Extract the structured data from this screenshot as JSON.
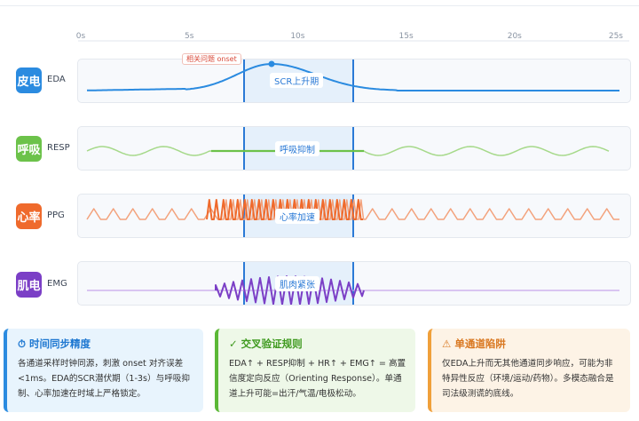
{
  "timeline": {
    "ticks": [
      "0s",
      "5s",
      "10s",
      "15s",
      "20s",
      "25s"
    ],
    "max_seconds": 25
  },
  "window": {
    "start_s": 7.5,
    "end_s": 12.5
  },
  "rows": [
    {
      "key": "eda",
      "icon_text": "皮电",
      "label": "EDA",
      "color": "#2b8be0",
      "highlight_text": "SCR上升期",
      "onset_text": "相关问题 onset"
    },
    {
      "key": "resp",
      "icon_text": "呼吸",
      "label": "RESP",
      "color": "#6cc24a",
      "highlight_text": "呼吸抑制"
    },
    {
      "key": "ppg",
      "icon_text": "心率",
      "label": "PPG",
      "color": "#ef6a2c",
      "highlight_text": "心率加速"
    },
    {
      "key": "emg",
      "icon_text": "肌电",
      "label": "EMG",
      "color": "#7b3fc6",
      "highlight_text": "肌肉紧张"
    }
  ],
  "cards": [
    {
      "key": "sync",
      "icon": "⏱",
      "title": "时间同步精度",
      "color": "#1f78d1",
      "body": "各通道采样时钟同源，刺激 onset 对齐误差<1ms。EDA的SCR潜伏期（1-3s）与呼吸抑制、心率加速在时域上严格锁定。"
    },
    {
      "key": "cross",
      "icon": "✓",
      "title": "交叉验证规则",
      "color": "#3f9a1f",
      "body": "EDA↑ + RESP抑制 + HR↑ + EMG↑ = 高置信度定向反应（Orienting Response）。单通道上升可能=出汗/气温/电极松动。"
    },
    {
      "key": "trap",
      "icon": "⚠",
      "title": "单通道陷阱",
      "color": "#d9771f",
      "body": "仅EDA上升而无其他通道同步响应，可能为非特异性反应（环境/运动/药物）。多模态融合是司法级测谎的底线。"
    }
  ]
}
